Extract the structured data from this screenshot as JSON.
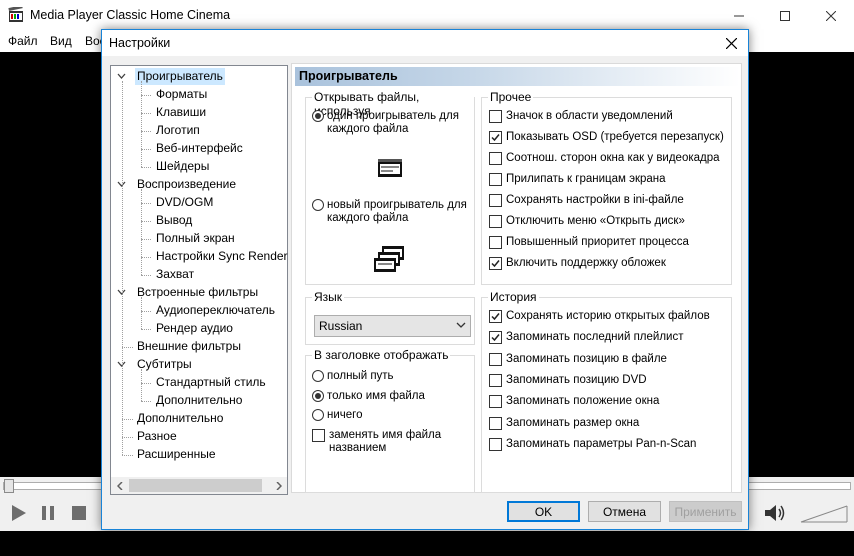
{
  "app": {
    "title": "Media Player Classic Home Cinema",
    "menu": [
      "Файл",
      "Вид",
      "Вос"
    ]
  },
  "dialog": {
    "title": "Настройки",
    "tree": {
      "items": [
        {
          "label": "Проигрыватель",
          "level": 0,
          "expanded": true,
          "selected": true
        },
        {
          "label": "Форматы",
          "level": 1
        },
        {
          "label": "Клавиши",
          "level": 1
        },
        {
          "label": "Логотип",
          "level": 1
        },
        {
          "label": "Веб-интерфейс",
          "level": 1
        },
        {
          "label": "Шейдеры",
          "level": 1
        },
        {
          "label": "Воспроизведение",
          "level": 0,
          "expanded": true
        },
        {
          "label": "DVD/OGM",
          "level": 1
        },
        {
          "label": "Вывод",
          "level": 1
        },
        {
          "label": "Полный экран",
          "level": 1
        },
        {
          "label": "Настройки Sync Render",
          "level": 1
        },
        {
          "label": "Захват",
          "level": 1
        },
        {
          "label": "Встроенные фильтры",
          "level": 0,
          "expanded": true
        },
        {
          "label": "Аудиопереключатель",
          "level": 1
        },
        {
          "label": "Рендер аудио",
          "level": 1
        },
        {
          "label": "Внешние фильтры",
          "level": 0
        },
        {
          "label": "Субтитры",
          "level": 0,
          "expanded": true
        },
        {
          "label": "Стандартный стиль",
          "level": 1
        },
        {
          "label": "Дополнительно",
          "level": 1
        },
        {
          "label": "Дополнительно",
          "level": 0
        },
        {
          "label": "Разное",
          "level": 0
        },
        {
          "label": "Расширенные",
          "level": 0
        }
      ]
    },
    "page": {
      "title": "Проигрыватель",
      "open_files": {
        "title": "Открывать файлы, используя",
        "single": {
          "line1": "один проигрыватель для",
          "line2": "каждого файла",
          "checked": true
        },
        "multi": {
          "line1": "новый проигрыватель для",
          "line2": "каждого файла",
          "checked": false
        }
      },
      "misc": {
        "title": "Прочее",
        "items": [
          {
            "label": "Значок в области уведомлений",
            "checked": false
          },
          {
            "label": "Показывать OSD (требуется перезапуск)",
            "checked": true
          },
          {
            "label": "Соотнош. сторон окна как у видеокадра",
            "checked": false
          },
          {
            "label": "Прилипать к границам экрана",
            "checked": false
          },
          {
            "label": "Сохранять настройки в ini-файле",
            "checked": false
          },
          {
            "label": "Отключить меню «Открыть диск»",
            "checked": false
          },
          {
            "label": "Повышенный приоритет процесса",
            "checked": false
          },
          {
            "label": "Включить поддержку обложек",
            "checked": true
          }
        ]
      },
      "language": {
        "title": "Язык",
        "value": "Russian"
      },
      "title_display": {
        "title": "В заголовке отображать",
        "full_path": "полный путь",
        "file_name": "только имя файла",
        "nothing": "ничего",
        "selected": "file_name",
        "replace": {
          "line1": "заменять имя файла",
          "line2": "названием",
          "checked": false
        }
      },
      "history": {
        "title": "История",
        "items": [
          {
            "label": "Сохранять историю открытых файлов",
            "checked": true
          },
          {
            "label": "Запоминать последний плейлист",
            "checked": true
          },
          {
            "label": "Запоминать позицию в файле",
            "checked": false
          },
          {
            "label": "Запоминать позицию DVD",
            "checked": false
          },
          {
            "label": "Запоминать положение окна",
            "checked": false
          },
          {
            "label": "Запоминать размер окна",
            "checked": false
          },
          {
            "label": "Запоминать параметры Pan-n-Scan",
            "checked": false
          }
        ]
      }
    },
    "buttons": {
      "ok": "OK",
      "cancel": "Отмена",
      "apply": "Применить"
    }
  },
  "colors": {
    "selection": "#cce8ff",
    "dialog_border": "#1883d7",
    "header_gradient_start": "#a9c2dc"
  }
}
